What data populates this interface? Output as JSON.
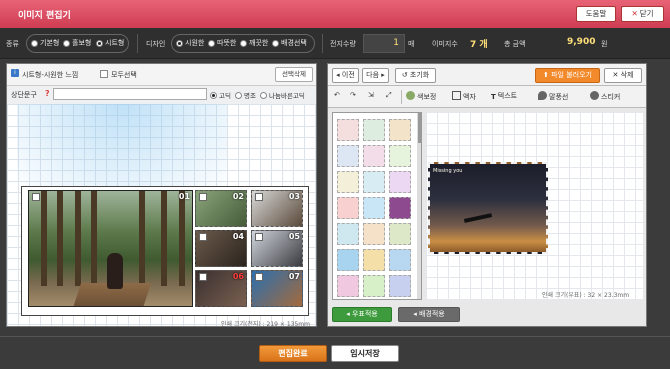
{
  "window": {
    "title": "이미지 편집기",
    "help_label": "도움말",
    "close_label": "닫기"
  },
  "options": {
    "type_label": "종류",
    "type_options": [
      "기본형",
      "홀보형",
      "시트형"
    ],
    "type_selected": "시트형",
    "design_label": "디자인",
    "design_options": [
      "시원한",
      "따뜻한",
      "깨끗한",
      "배경선택"
    ],
    "design_selected": "시원한",
    "sheet_qty_label": "전지수량",
    "sheet_qty_value": "1",
    "sheet_qty_unit": "매",
    "image_count_label": "이미지수",
    "image_count_value": "7 개",
    "total_label": "총 금액",
    "total_value": "9,900",
    "total_unit": "원"
  },
  "left_panel": {
    "template_name": "시트형-시원한 느낌",
    "select_all_label": "모두선택",
    "delete_selected_label": "선택삭제",
    "upper_text_label": "상단문구",
    "upper_text_value": "",
    "font_options": [
      "고딕",
      "명조",
      "나눔바른고딕"
    ],
    "font_selected": "고딕",
    "tiles": [
      "01",
      "02",
      "03",
      "04",
      "05",
      "06",
      "07"
    ],
    "footer": "인쇄 크기(전지) : 219 × 135mm"
  },
  "right_panel": {
    "prev_label": "이전",
    "next_label": "다음",
    "reset_label": "초기화",
    "load_file_label": "파일 불러오기",
    "delete_label": "삭제",
    "tools": [
      "색보정",
      "액자",
      "텍스트",
      "말풍선",
      "스티커"
    ],
    "preview_caption": "Missing you",
    "footer": "인쇄 크기(우표) : 32 × 23.3mm",
    "apply_stamp_label": "우표적용",
    "apply_bg_label": "배경적용"
  },
  "actions": {
    "done_label": "편집완료",
    "temp_save_label": "임시저장"
  },
  "colors": {
    "title_bar": "#d94a5e",
    "accent_orange": "#f28a2c",
    "apply_green": "#3d9b3d"
  }
}
